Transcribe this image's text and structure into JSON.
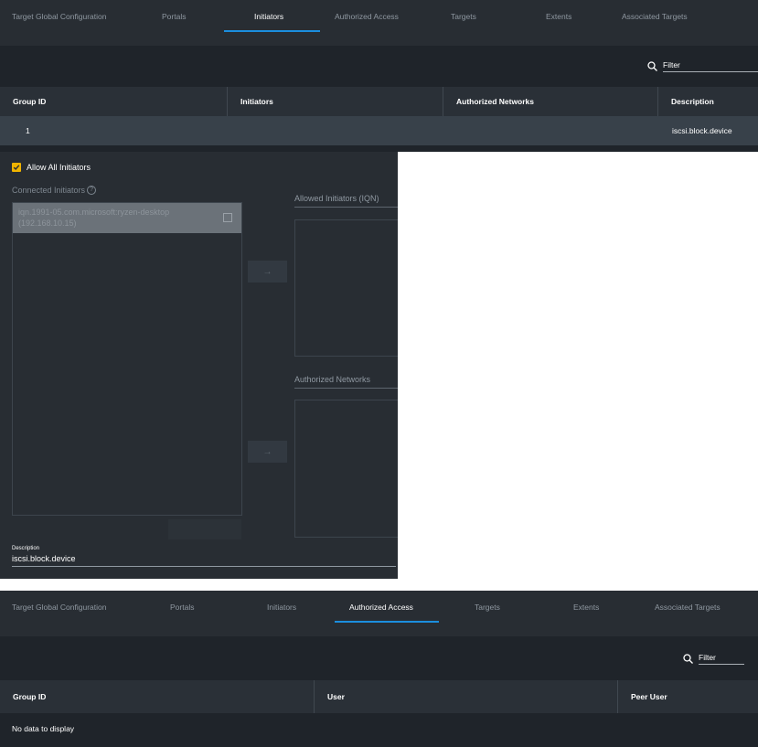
{
  "tabs": [
    "Target Global Configuration",
    "Portals",
    "Initiators",
    "Authorized Access",
    "Targets",
    "Extents",
    "Associated Targets"
  ],
  "initiators_view": {
    "active_tab": "Initiators",
    "filter_label": "Filter",
    "columns": [
      "Group ID",
      "Initiators",
      "Authorized Networks",
      "Description"
    ],
    "rows": [
      {
        "group_id": "1",
        "initiators": "",
        "authorized_networks": "",
        "description": "iscsi.block.device"
      }
    ],
    "form": {
      "allow_all_label": "Allow All Initiators",
      "allow_all_checked": true,
      "connected_label": "Connected Initiators",
      "connected_items": [
        {
          "line1": "iqn.1991-05.com.microsoft:ryzen-desktop",
          "line2": "(192.168.10.15)"
        }
      ],
      "move_right_symbol": "→",
      "allowed_initiators_label": "Allowed Initiators (IQN)",
      "authorized_networks_label": "Authorized Networks",
      "description_label": "Description",
      "description_value": "iscsi.block.device"
    }
  },
  "authorized_access_view": {
    "active_tab": "Authorized Access",
    "filter_label": "Filter",
    "columns": [
      "Group ID",
      "User",
      "Peer User"
    ],
    "empty_text": "No data to display"
  },
  "colors": {
    "background": "#282d33",
    "accent": "#1b8ede",
    "checkbox": "#f0b400"
  },
  "icons": [
    "search-icon",
    "check-icon",
    "help-icon",
    "arrow-right-icon"
  ]
}
